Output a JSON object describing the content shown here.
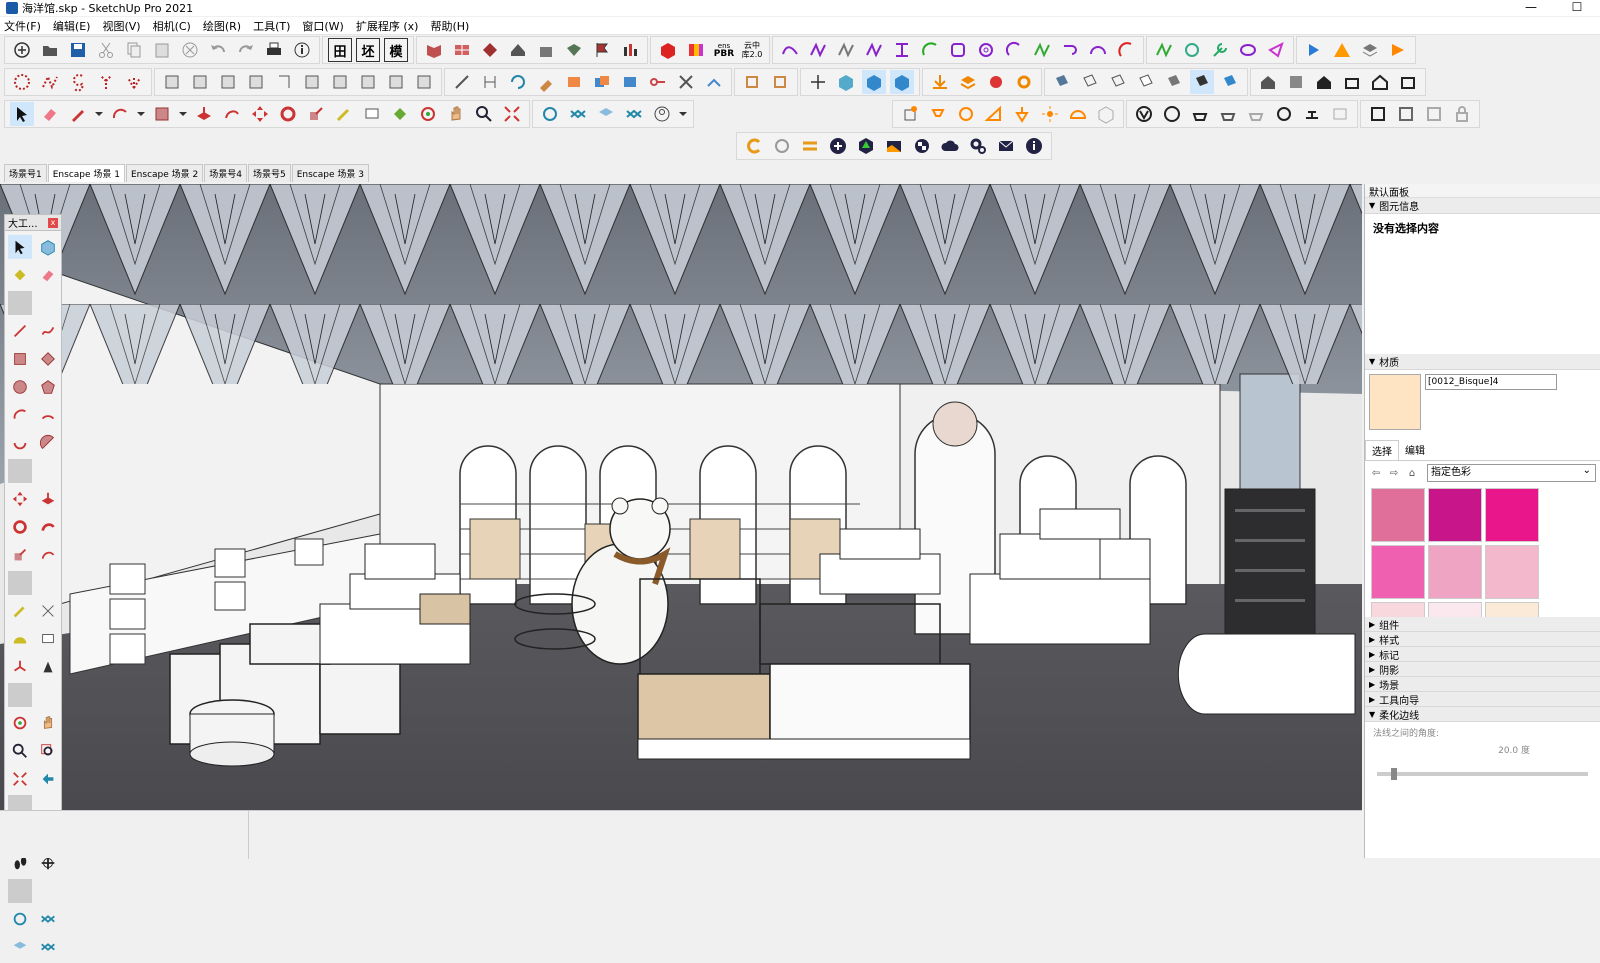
{
  "window": {
    "title": "海洋馆.skp - SketchUp Pro 2021",
    "minimize": "—",
    "maximize": "☐"
  },
  "menu": [
    "文件(F)",
    "编辑(E)",
    "视图(V)",
    "相机(C)",
    "绘图(R)",
    "工具(T)",
    "窗口(W)",
    "扩展程序 (x)",
    "帮助(H)"
  ],
  "toolbar_text": {
    "t1": "田",
    "t2": "坯",
    "t3": "模",
    "pbr_top": "ens",
    "pbr_bottom": "PBR",
    "cloud_top": "云中",
    "cloud_bottom": "库2.0"
  },
  "scene_tabs": [
    "场景号1",
    "Enscape 场景 1",
    "Enscape 场景 2",
    "场景号4",
    "场景号5",
    "Enscape 场景 3"
  ],
  "active_scene_index": 1,
  "left_tools": {
    "title": "大工...",
    "close": "x"
  },
  "panel": {
    "title": "默认面板",
    "entity_info": {
      "heading": "图元信息",
      "empty_text": "没有选择内容"
    },
    "materials": {
      "heading": "材质",
      "name": "[0012_Bisque]4",
      "swatch_color": "#FFE4C4",
      "tab_select": "选择",
      "tab_edit": "编辑",
      "collection": "指定色彩",
      "swatches": [
        "#E0709A",
        "#C8168A",
        "#E8168A",
        "#F060B0",
        "#F0A4C4",
        "#F4B8CC",
        "#F8D8DC",
        "#FAE8EE",
        "#FCEAD8"
      ]
    },
    "collapsed": [
      "组件",
      "样式",
      "标记",
      "阴影",
      "场景",
      "工具向导"
    ],
    "soften": {
      "heading": "柔化边线",
      "label": "法线之间的角度:",
      "value": "20.0 度"
    }
  }
}
